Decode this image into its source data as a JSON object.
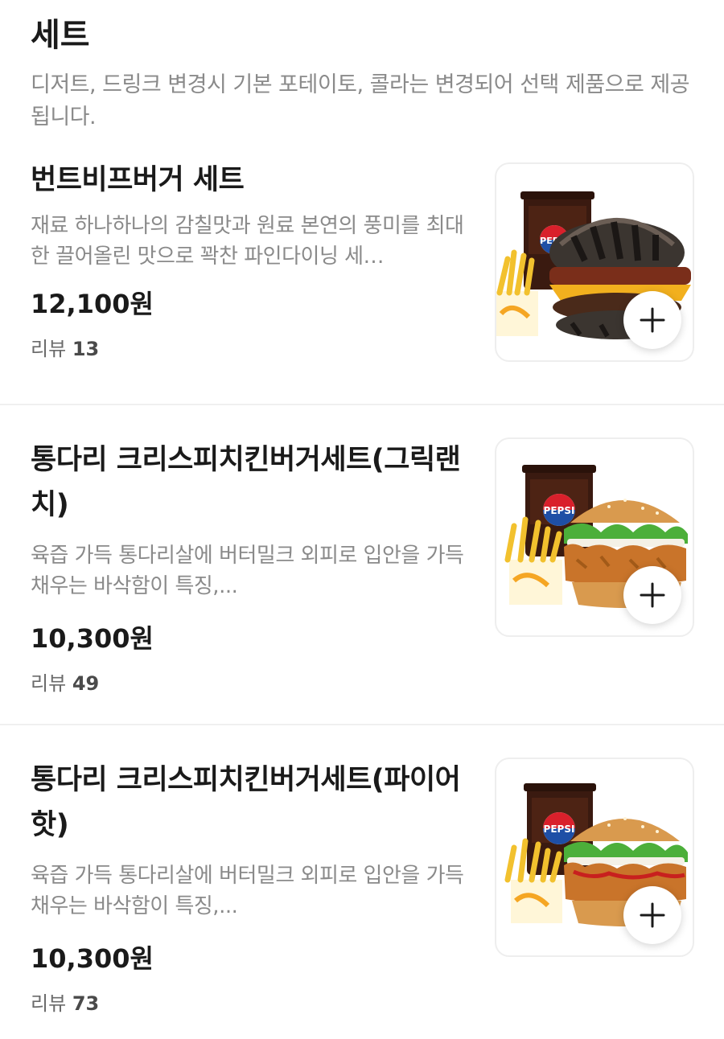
{
  "section": {
    "title": "세트",
    "description": "디저트, 드링크 변경시 기본 포테이토, 콜라는 변경되어 선택 제품으로 제공 됩니다."
  },
  "colors": {
    "text": "#1a1a1a",
    "muted": "#8a8a8a",
    "divider": "#f0f0f0",
    "cola": "#3a1a10",
    "bun": "#d99a4e",
    "fries": "#f2c12e"
  },
  "items": [
    {
      "name": "번트비프버거 세트",
      "description": "재료 하나하나의 감칠맛과 원료 본연의 풍미를 최대한 끌어올린 맛으로 꽉찬 파인다이닝 세…",
      "price": "12,100원",
      "review_label": "리뷰",
      "review_count": "13",
      "image_icon": "burnt-beef-burger-set-image",
      "add_icon": "plus-icon"
    },
    {
      "name": "통다리 크리스피치킨버거세트(그릭랜치)",
      "description": "육즙 가득 통다리살에 버터밀크 외피로 입안을 가득 채우는 바삭함이 특징,...",
      "price": "10,300원",
      "review_label": "리뷰",
      "review_count": "49",
      "image_icon": "crispy-chicken-burger-set-image",
      "add_icon": "plus-icon"
    },
    {
      "name": "통다리 크리스피치킨버거세트(파이어핫)",
      "description": "육즙 가득 통다리살에 버터밀크 외피로 입안을 가득 채우는 바삭함이 특징,...",
      "price": "10,300원",
      "review_label": "리뷰",
      "review_count": "73",
      "image_icon": "crispy-chicken-burger-set-image",
      "add_icon": "plus-icon"
    }
  ],
  "brand_text": {
    "pepsi": "PEPSI"
  }
}
